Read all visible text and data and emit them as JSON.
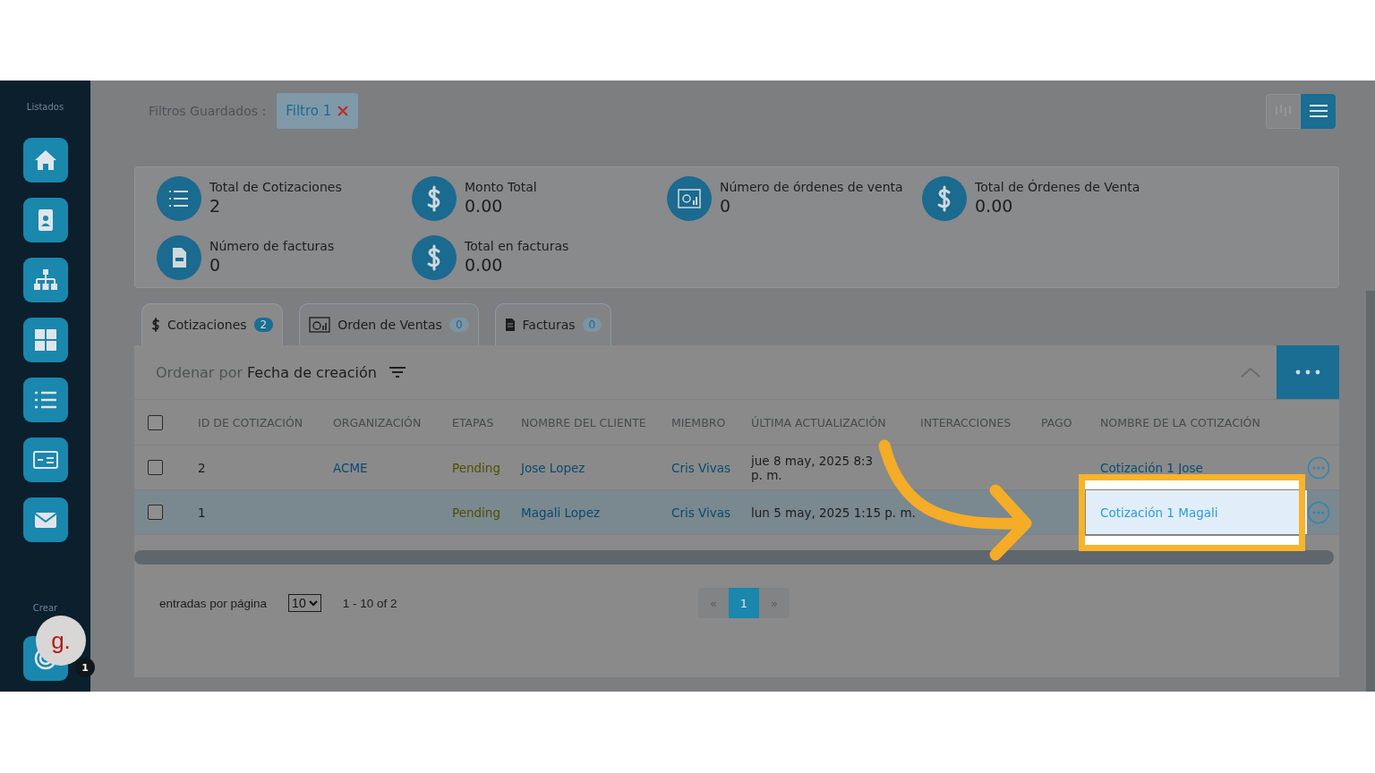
{
  "sidebar": {
    "heading": "Listados",
    "create_label": "Crear"
  },
  "avatar": {
    "letter": "g.",
    "badge": "1"
  },
  "saved_filters": {
    "label": "Filtros Guardados :",
    "chips": [
      {
        "label": "Filtro 1"
      }
    ]
  },
  "view_toggle": [
    {
      "selected": false
    },
    {
      "selected": true
    }
  ],
  "stats": [
    {
      "label": "Total de Cotizaciones",
      "value": "2"
    },
    {
      "label": "Monto Total",
      "value": "0.00"
    },
    {
      "label": "Número de órdenes de venta",
      "value": "0"
    },
    {
      "label": "Total de Órdenes de Venta",
      "value": "0.00"
    },
    {
      "label": "Número de facturas",
      "value": "0"
    },
    {
      "label": "Total en facturas",
      "value": "0.00"
    }
  ],
  "tabs": [
    {
      "label": "Cotizaciones",
      "count": "2",
      "selected": true
    },
    {
      "label": "Orden de Ventas",
      "count": "0",
      "selected": false
    },
    {
      "label": "Facturas",
      "count": "0",
      "selected": false
    }
  ],
  "sort": {
    "prefix": "Ordenar por",
    "value": "Fecha de creación"
  },
  "table": {
    "header_checked": false,
    "columns": [
      {
        "label": "ID DE COTIZACIÓN"
      },
      {
        "label": "ORGANIZACIÓN",
        "kind": "link"
      },
      {
        "label": "ETAPAS",
        "kind": "stage"
      },
      {
        "label": "NOMBRE DEL CLIENTE",
        "kind": "link"
      },
      {
        "label": "MIEMBRO",
        "kind": "link"
      },
      {
        "label": "ÚLTIMA ACTUALIZACIÓN"
      },
      {
        "label": "INTERACCIONES"
      },
      {
        "label": "PAGO"
      },
      {
        "label": "NOMBRE DE LA COTIZACIÓN",
        "kind": "link"
      }
    ],
    "rows": [
      {
        "checked": false,
        "selected": false,
        "callout": false,
        "cells": [
          "2",
          "ACME",
          "Pending",
          "Jose Lopez",
          "Cris Vivas",
          "jue 8 may, 2025 8:3\np. m.",
          "",
          "",
          "Cotización 1 Jose"
        ]
      },
      {
        "checked": false,
        "selected": true,
        "callout": true,
        "cells": [
          "1",
          "",
          "Pending",
          "Magali Lopez",
          "Cris Vivas",
          "lun 5 may, 2025 1:15 p. m.",
          "",
          "",
          "Cotización 1 Magali"
        ]
      }
    ]
  },
  "footer": {
    "per_page_label": "entradas por página",
    "per_page": "10",
    "range": "1 - 10 of 2",
    "pages": [
      {
        "label": "«",
        "selected": false
      },
      {
        "label": "1",
        "selected": true
      },
      {
        "label": "»",
        "selected": false
      }
    ]
  }
}
